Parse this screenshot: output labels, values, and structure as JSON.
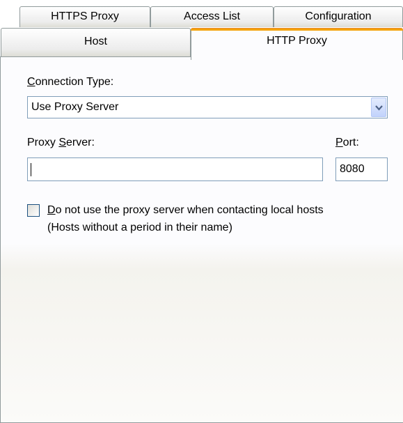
{
  "tabs": {
    "back_row": [
      {
        "label": "HTTPS Proxy"
      },
      {
        "label": "Access List"
      },
      {
        "label": "Configuration"
      }
    ],
    "front_row": [
      {
        "label": "Host"
      },
      {
        "label": "HTTP Proxy",
        "selected": true
      }
    ]
  },
  "connection_type": {
    "label_mnemonic": "C",
    "label_rest": "onnection Type:",
    "selected_value": "Use Proxy Server"
  },
  "proxy_server": {
    "label_before": "Proxy ",
    "label_mnemonic": "S",
    "label_after": "erver:",
    "value": ""
  },
  "port": {
    "label_mnemonic": "P",
    "label_rest": "ort:",
    "value": "8080"
  },
  "local_hosts": {
    "checked": false,
    "label_mnemonic": "D",
    "label_line1_rest": "o not use the proxy server when contacting local hosts",
    "label_line2": "(Hosts without a period in their name)"
  },
  "colors": {
    "selected_tab_accent": "#f5a30c",
    "border": "#919b9c",
    "input_border": "#7f9db9"
  },
  "icons": {
    "dropdown": "chevron-down-icon"
  }
}
